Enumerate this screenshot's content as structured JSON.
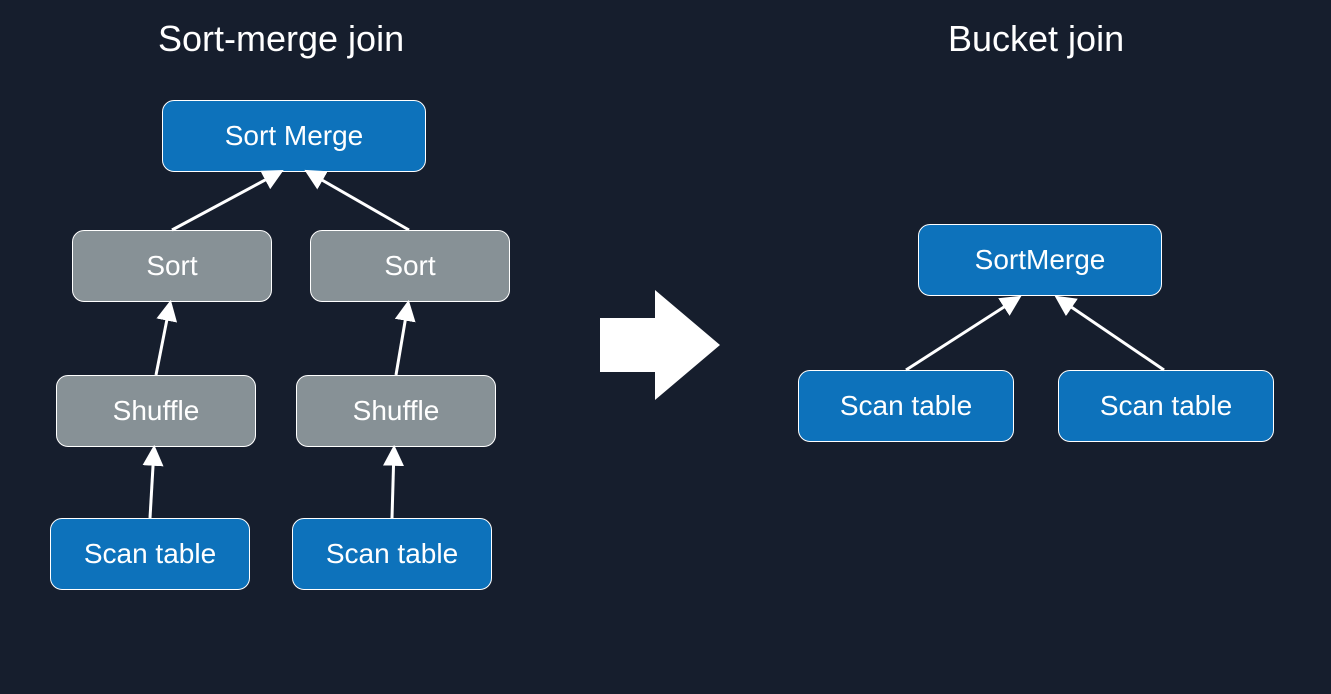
{
  "diagram": {
    "left": {
      "title": "Sort-merge join",
      "nodes": {
        "sortMerge": "Sort Merge",
        "sortL": "Sort",
        "sortR": "Sort",
        "shuffleL": "Shuffle",
        "shuffleR": "Shuffle",
        "scanL": "Scan table",
        "scanR": "Scan table"
      }
    },
    "right": {
      "title": "Bucket join",
      "nodes": {
        "sortMerge": "SortMerge",
        "scanL": "Scan table",
        "scanR": "Scan table"
      }
    },
    "colors": {
      "background": "#161e2d",
      "primary": "#0d72bb",
      "secondary": "#879196",
      "outline": "#ffffff"
    }
  }
}
